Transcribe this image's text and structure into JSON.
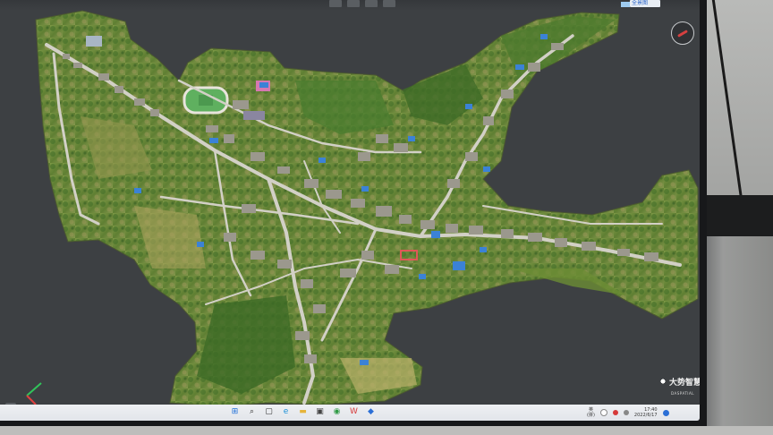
{
  "toolbar": {
    "active_tool_label": "全景图"
  },
  "map": {
    "description_hidden": true,
    "colors": {
      "background": "#3d4043",
      "farmland": "#6f8a3a",
      "forest": "#3f6e2a",
      "road": "#cfcfc6",
      "roof_blue": "#3b82d6",
      "roof_gray": "#8e8c84",
      "track_red": "#c64040",
      "field_green": "#5aa45a"
    }
  },
  "compass": {
    "icon": "compass-icon"
  },
  "axis": {
    "icon": "xyz-axis-icon"
  },
  "brand": {
    "name": "大势智慧",
    "subtitle": "DASPATIAL"
  },
  "menu_button": {
    "icon": "menu-icon",
    "glyph": "≡"
  },
  "taskbar": {
    "apps": [
      {
        "name": "start",
        "icon": "windows-start-icon",
        "glyph": "⊞",
        "color": "#1f6fd8"
      },
      {
        "name": "search",
        "icon": "search-icon",
        "glyph": "⌕",
        "color": "#333333"
      },
      {
        "name": "task-view",
        "icon": "task-view-icon",
        "glyph": "▢",
        "color": "#333333"
      },
      {
        "name": "edge",
        "icon": "edge-browser-icon",
        "glyph": "e",
        "color": "#1a8fd6"
      },
      {
        "name": "explorer",
        "icon": "folder-icon",
        "glyph": "▬",
        "color": "#e6b43a"
      },
      {
        "name": "store",
        "icon": "store-icon",
        "glyph": "▣",
        "color": "#444444"
      },
      {
        "name": "chrome",
        "icon": "chrome-icon",
        "glyph": "◉",
        "color": "#2f9a45"
      },
      {
        "name": "wps",
        "icon": "wps-icon",
        "glyph": "W",
        "color": "#d63a3a"
      },
      {
        "name": "app",
        "icon": "app-icon",
        "glyph": "◆",
        "color": "#2b6fd6"
      }
    ],
    "tray": {
      "lang_top": "英",
      "lang_bottom": "(拼)",
      "time": "17:40",
      "date": "2022/6/17"
    }
  }
}
